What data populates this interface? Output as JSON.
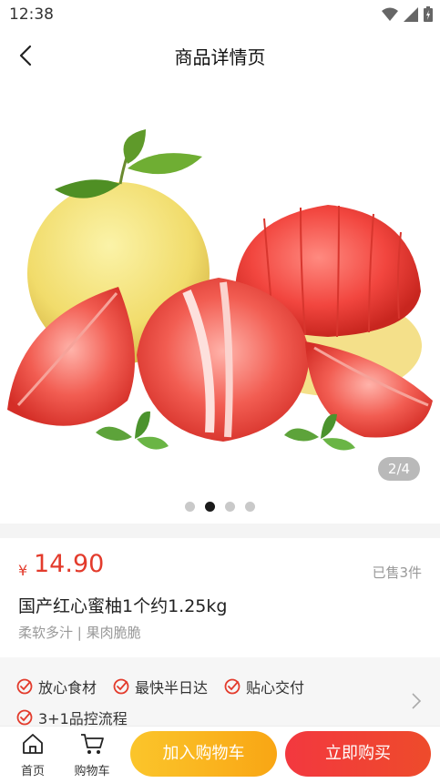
{
  "status_bar": {
    "time": "12:38",
    "icons": [
      "wifi-icon",
      "signal-icon",
      "battery-icon"
    ]
  },
  "nav": {
    "title": "商品详情页",
    "back_icon": "chevron-left-icon"
  },
  "gallery": {
    "image_description_icon": "pomelo-product-image",
    "counter": "2/4",
    "current_index": 2,
    "total": 4
  },
  "product": {
    "currency": "¥",
    "price": "14.90",
    "sold": "已售3件",
    "title": "国产红心蜜柚1个约1.25kg",
    "subtitle": "柔软多汁 | 果肉脆脆"
  },
  "guarantees": {
    "row1": [
      "放心食材",
      "最快半日达",
      "贴心交付"
    ],
    "row2": [
      "3+1品控流程"
    ],
    "arrow_icon": "chevron-right-icon"
  },
  "bottom_bar": {
    "home_label": "首页",
    "cart_label": "购物车",
    "add_cart_label": "加入购物车",
    "buy_now_label": "立即购买"
  },
  "colors": {
    "price": "#e33b2c",
    "add_cart": "#fbb423",
    "buy_now": "#f0403a",
    "check": "#e33b2c"
  }
}
